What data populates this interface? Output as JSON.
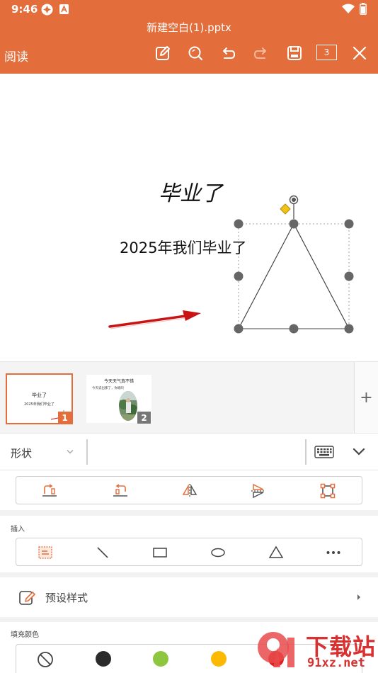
{
  "status_bar": {
    "time": "9:46"
  },
  "header": {
    "filename": "新建空白(1).pptx",
    "read_label": "阅读",
    "page_count": "3"
  },
  "slide": {
    "title": "毕业了",
    "subtitle": "2025年我们毕业了"
  },
  "thumbnails": [
    {
      "number": "1",
      "title": "毕业了",
      "subtitle": "2025年我们毕业了",
      "selected": true
    },
    {
      "number": "2",
      "title": "今天天气真不错",
      "bullet": "今天说出那了，你唱吗",
      "selected": false
    }
  ],
  "add_slide_label": "+",
  "shape_bar": {
    "label": "形状"
  },
  "arrange_icons": [
    "bring-forward-icon",
    "send-backward-icon",
    "flip-horizontal-icon",
    "flip-vertical-icon",
    "edit-points-icon"
  ],
  "insert": {
    "label": "插入",
    "icons": [
      "textbox-icon",
      "line-icon",
      "rectangle-icon",
      "ellipse-icon",
      "triangle-icon",
      "more-icon"
    ]
  },
  "preset": {
    "label": "预设样式"
  },
  "fill": {
    "label": "填充颜色",
    "colors": [
      "none",
      "#2b2b2b",
      "#8dc63f",
      "#fbb901",
      "#e02020"
    ]
  },
  "watermark": {
    "text": "下载站",
    "domain": "91xz.net"
  },
  "colors": {
    "accent": "#e36e3c"
  }
}
